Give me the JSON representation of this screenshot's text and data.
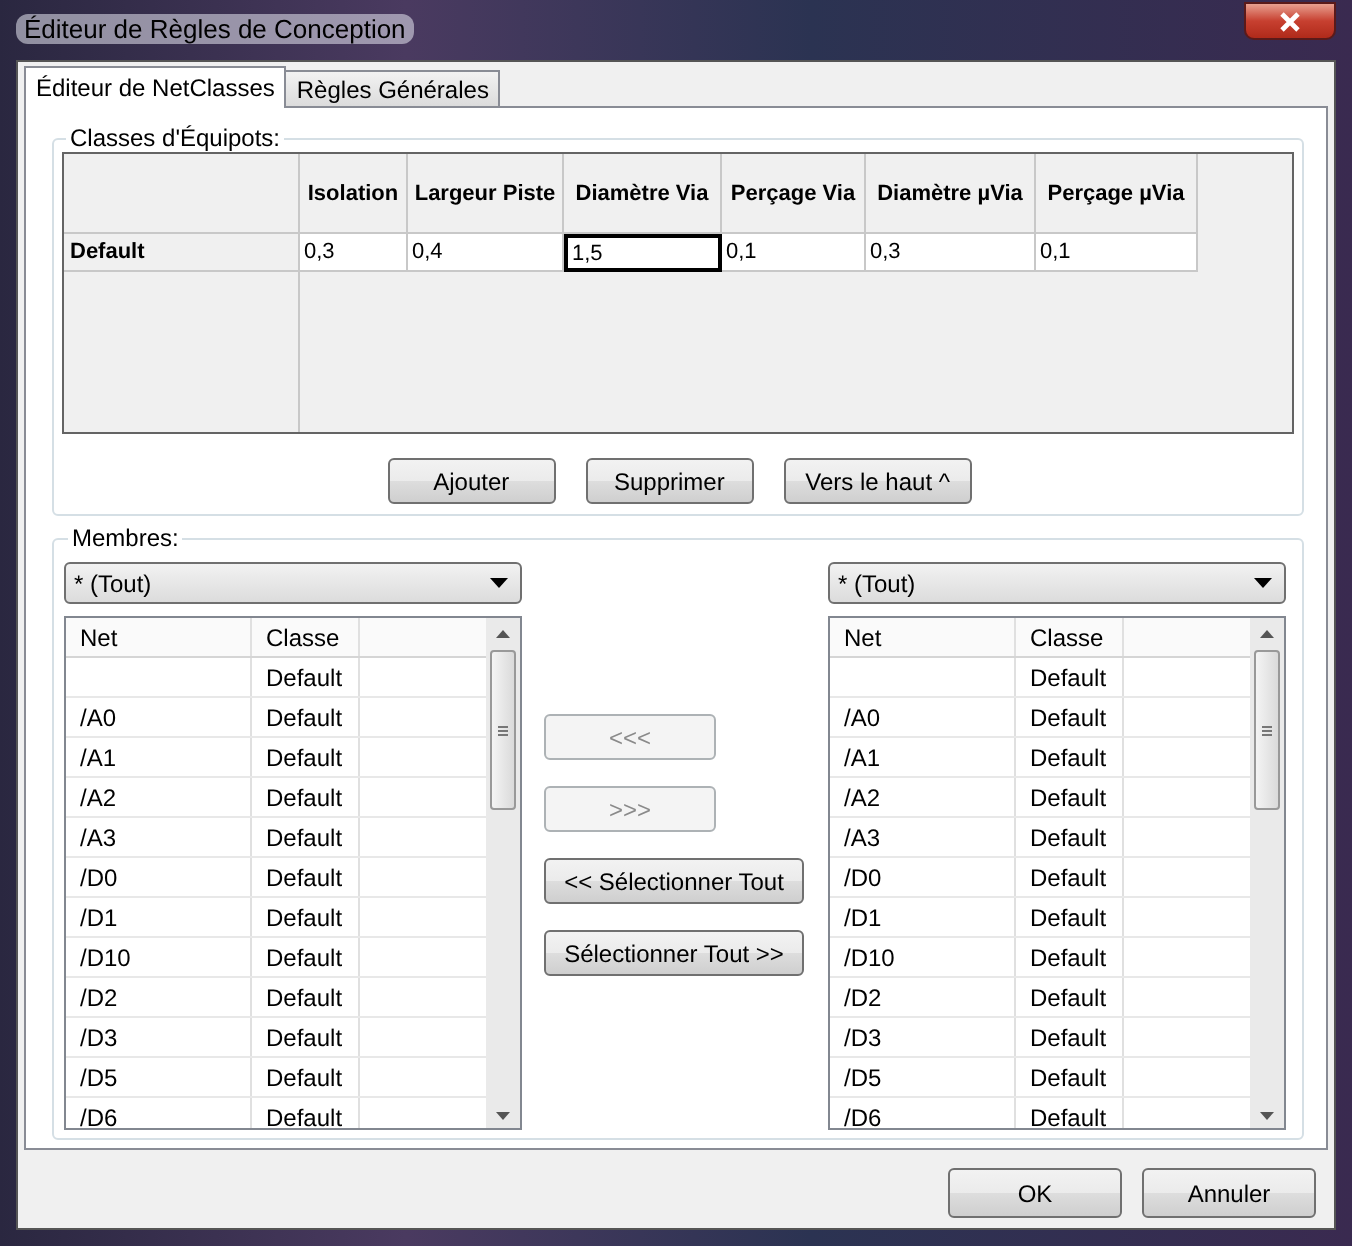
{
  "window": {
    "title": "Éditeur de Règles de Conception"
  },
  "tabs": [
    {
      "label": "Éditeur de NetClasses",
      "selected": true
    },
    {
      "label": "Règles Générales",
      "selected": false
    }
  ],
  "netclasses": {
    "group_label": "Classes d'Équipots:",
    "columns": [
      "Isolation",
      "Largeur Piste",
      "Diamètre Via",
      "Perçage Via",
      "Diamètre µVia",
      "Perçage µVia"
    ],
    "rows": [
      {
        "name": "Default",
        "cells": [
          {
            "value": "0,3",
            "focused": false
          },
          {
            "value": "0,4",
            "focused": false
          },
          {
            "value": "1,5",
            "focused": true
          },
          {
            "value": "0,1",
            "focused": false
          },
          {
            "value": "0,3",
            "focused": false
          },
          {
            "value": "0,1",
            "focused": false
          }
        ]
      }
    ],
    "buttons": [
      "Ajouter",
      "Supprimer",
      "Vers le haut ^"
    ]
  },
  "members": {
    "group_label": "Membres:",
    "lists": [
      {
        "filter": "* (Tout)",
        "columns": [
          "Net",
          "Classe"
        ],
        "rows": [
          {
            "classe": "Default"
          },
          {
            "net": "/A0",
            "classe": "Default"
          },
          {
            "net": "/A1",
            "classe": "Default"
          },
          {
            "net": "/A2",
            "classe": "Default"
          },
          {
            "net": "/A3",
            "classe": "Default"
          },
          {
            "net": "/D0",
            "classe": "Default"
          },
          {
            "net": "/D1",
            "classe": "Default"
          },
          {
            "net": "/D10",
            "classe": "Default"
          },
          {
            "net": "/D2",
            "classe": "Default"
          },
          {
            "net": "/D3",
            "classe": "Default"
          },
          {
            "net": "/D5",
            "classe": "Default"
          },
          {
            "net": "/D6",
            "classe": "Default"
          }
        ]
      },
      {
        "filter": "* (Tout)",
        "columns": [
          "Net",
          "Classe"
        ],
        "rows": [
          {
            "classe": "Default"
          },
          {
            "net": "/A0",
            "classe": "Default"
          },
          {
            "net": "/A1",
            "classe": "Default"
          },
          {
            "net": "/A2",
            "classe": "Default"
          },
          {
            "net": "/A3",
            "classe": "Default"
          },
          {
            "net": "/D0",
            "classe": "Default"
          },
          {
            "net": "/D1",
            "classe": "Default"
          },
          {
            "net": "/D10",
            "classe": "Default"
          },
          {
            "net": "/D2",
            "classe": "Default"
          },
          {
            "net": "/D3",
            "classe": "Default"
          },
          {
            "net": "/D5",
            "classe": "Default"
          },
          {
            "net": "/D6",
            "classe": "Default"
          }
        ]
      }
    ],
    "transfer_buttons": [
      {
        "label": "<<<",
        "disabled": true
      },
      {
        "label": ">>>",
        "disabled": true
      },
      {
        "label": "<< Sélectionner Tout",
        "disabled": false
      },
      {
        "label": "Sélectionner Tout >>",
        "disabled": false
      }
    ]
  },
  "dialog_buttons": [
    "OK",
    "Annuler"
  ]
}
